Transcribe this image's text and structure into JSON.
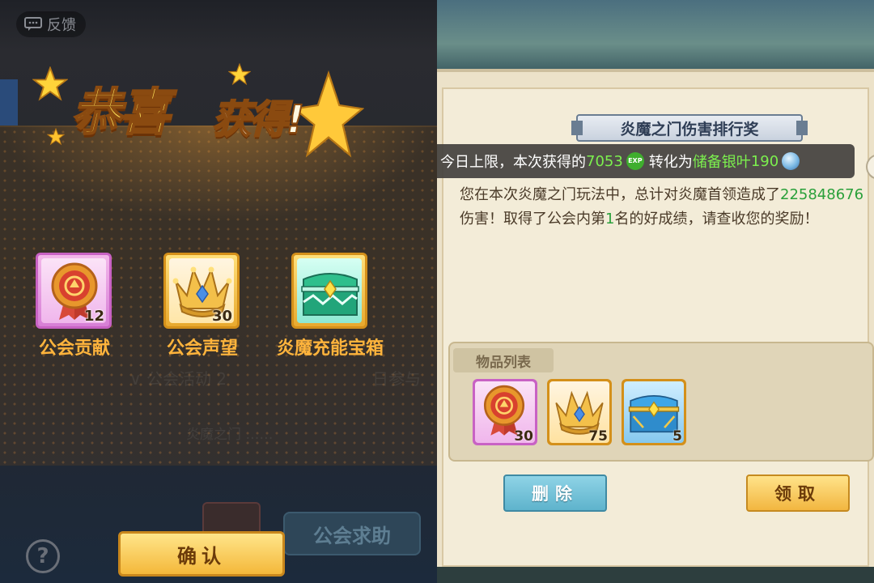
{
  "left": {
    "feedback_label": "反馈",
    "title_part1": "恭喜",
    "title_part2": "获得!",
    "rewards": [
      {
        "name": "公会贡献",
        "count": "12",
        "icon": "guild-medal-icon",
        "rarity": "purple"
      },
      {
        "name": "公会声望",
        "count": "30",
        "icon": "gold-crown-icon",
        "rarity": "gold"
      },
      {
        "name": "炎魔充能宝箱",
        "count": "",
        "icon": "teal-chest-icon",
        "rarity": "gold"
      }
    ],
    "confirm_label": "确认",
    "guild_help_label": "公会求助",
    "help_label": "?"
  },
  "right": {
    "mail_title": "炎魔之门伤害排行奖",
    "toast": {
      "prefix": "今日上限，本次获得的",
      "exp_value": "7053",
      "exp_icon_label": "EXP",
      "mid": "转化为",
      "reserve_label": "储备银叶",
      "reserve_value": "190"
    },
    "body": {
      "line1": "您在本次炎魔之门玩法中，总计对炎魔首领造成了",
      "damage": "225848676",
      "line2": "伤害！取得了公会内第",
      "rank": "1",
      "line3": "名的好成绩，请查收您的奖励！"
    },
    "items_tab_label": "物品列表",
    "items": [
      {
        "count": "30",
        "icon": "guild-medal-icon",
        "rarity": "purple"
      },
      {
        "count": "75",
        "icon": "gold-crown-icon",
        "rarity": "gold"
      },
      {
        "count": "5",
        "icon": "blue-chest-icon",
        "rarity": "gold"
      }
    ],
    "delete_label": "删除",
    "claim_label": "领取"
  },
  "colors": {
    "accent_gold": "#ffb43c",
    "green_value": "#2aa03a",
    "toast_green": "#7cf04e"
  }
}
